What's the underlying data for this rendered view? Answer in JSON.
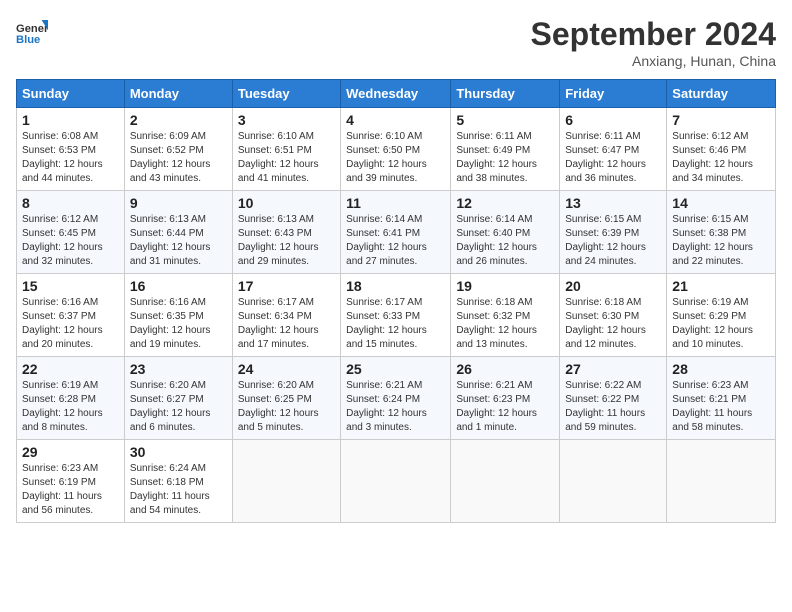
{
  "logo": {
    "line1": "General",
    "line2": "Blue"
  },
  "title": "September 2024",
  "location": "Anxiang, Hunan, China",
  "days_of_week": [
    "Sunday",
    "Monday",
    "Tuesday",
    "Wednesday",
    "Thursday",
    "Friday",
    "Saturday"
  ],
  "weeks": [
    [
      {
        "day": 1,
        "sunrise": "6:08 AM",
        "sunset": "6:53 PM",
        "daylight": "12 hours and 44 minutes."
      },
      {
        "day": 2,
        "sunrise": "6:09 AM",
        "sunset": "6:52 PM",
        "daylight": "12 hours and 43 minutes."
      },
      {
        "day": 3,
        "sunrise": "6:10 AM",
        "sunset": "6:51 PM",
        "daylight": "12 hours and 41 minutes."
      },
      {
        "day": 4,
        "sunrise": "6:10 AM",
        "sunset": "6:50 PM",
        "daylight": "12 hours and 39 minutes."
      },
      {
        "day": 5,
        "sunrise": "6:11 AM",
        "sunset": "6:49 PM",
        "daylight": "12 hours and 38 minutes."
      },
      {
        "day": 6,
        "sunrise": "6:11 AM",
        "sunset": "6:47 PM",
        "daylight": "12 hours and 36 minutes."
      },
      {
        "day": 7,
        "sunrise": "6:12 AM",
        "sunset": "6:46 PM",
        "daylight": "12 hours and 34 minutes."
      }
    ],
    [
      {
        "day": 8,
        "sunrise": "6:12 AM",
        "sunset": "6:45 PM",
        "daylight": "12 hours and 32 minutes."
      },
      {
        "day": 9,
        "sunrise": "6:13 AM",
        "sunset": "6:44 PM",
        "daylight": "12 hours and 31 minutes."
      },
      {
        "day": 10,
        "sunrise": "6:13 AM",
        "sunset": "6:43 PM",
        "daylight": "12 hours and 29 minutes."
      },
      {
        "day": 11,
        "sunrise": "6:14 AM",
        "sunset": "6:41 PM",
        "daylight": "12 hours and 27 minutes."
      },
      {
        "day": 12,
        "sunrise": "6:14 AM",
        "sunset": "6:40 PM",
        "daylight": "12 hours and 26 minutes."
      },
      {
        "day": 13,
        "sunrise": "6:15 AM",
        "sunset": "6:39 PM",
        "daylight": "12 hours and 24 minutes."
      },
      {
        "day": 14,
        "sunrise": "6:15 AM",
        "sunset": "6:38 PM",
        "daylight": "12 hours and 22 minutes."
      }
    ],
    [
      {
        "day": 15,
        "sunrise": "6:16 AM",
        "sunset": "6:37 PM",
        "daylight": "12 hours and 20 minutes."
      },
      {
        "day": 16,
        "sunrise": "6:16 AM",
        "sunset": "6:35 PM",
        "daylight": "12 hours and 19 minutes."
      },
      {
        "day": 17,
        "sunrise": "6:17 AM",
        "sunset": "6:34 PM",
        "daylight": "12 hours and 17 minutes."
      },
      {
        "day": 18,
        "sunrise": "6:17 AM",
        "sunset": "6:33 PM",
        "daylight": "12 hours and 15 minutes."
      },
      {
        "day": 19,
        "sunrise": "6:18 AM",
        "sunset": "6:32 PM",
        "daylight": "12 hours and 13 minutes."
      },
      {
        "day": 20,
        "sunrise": "6:18 AM",
        "sunset": "6:30 PM",
        "daylight": "12 hours and 12 minutes."
      },
      {
        "day": 21,
        "sunrise": "6:19 AM",
        "sunset": "6:29 PM",
        "daylight": "12 hours and 10 minutes."
      }
    ],
    [
      {
        "day": 22,
        "sunrise": "6:19 AM",
        "sunset": "6:28 PM",
        "daylight": "12 hours and 8 minutes."
      },
      {
        "day": 23,
        "sunrise": "6:20 AM",
        "sunset": "6:27 PM",
        "daylight": "12 hours and 6 minutes."
      },
      {
        "day": 24,
        "sunrise": "6:20 AM",
        "sunset": "6:25 PM",
        "daylight": "12 hours and 5 minutes."
      },
      {
        "day": 25,
        "sunrise": "6:21 AM",
        "sunset": "6:24 PM",
        "daylight": "12 hours and 3 minutes."
      },
      {
        "day": 26,
        "sunrise": "6:21 AM",
        "sunset": "6:23 PM",
        "daylight": "12 hours and 1 minute."
      },
      {
        "day": 27,
        "sunrise": "6:22 AM",
        "sunset": "6:22 PM",
        "daylight": "11 hours and 59 minutes."
      },
      {
        "day": 28,
        "sunrise": "6:23 AM",
        "sunset": "6:21 PM",
        "daylight": "11 hours and 58 minutes."
      }
    ],
    [
      {
        "day": 29,
        "sunrise": "6:23 AM",
        "sunset": "6:19 PM",
        "daylight": "11 hours and 56 minutes."
      },
      {
        "day": 30,
        "sunrise": "6:24 AM",
        "sunset": "6:18 PM",
        "daylight": "11 hours and 54 minutes."
      },
      null,
      null,
      null,
      null,
      null
    ]
  ],
  "labels": {
    "sunrise": "Sunrise:",
    "sunset": "Sunset:",
    "daylight": "Daylight:"
  }
}
